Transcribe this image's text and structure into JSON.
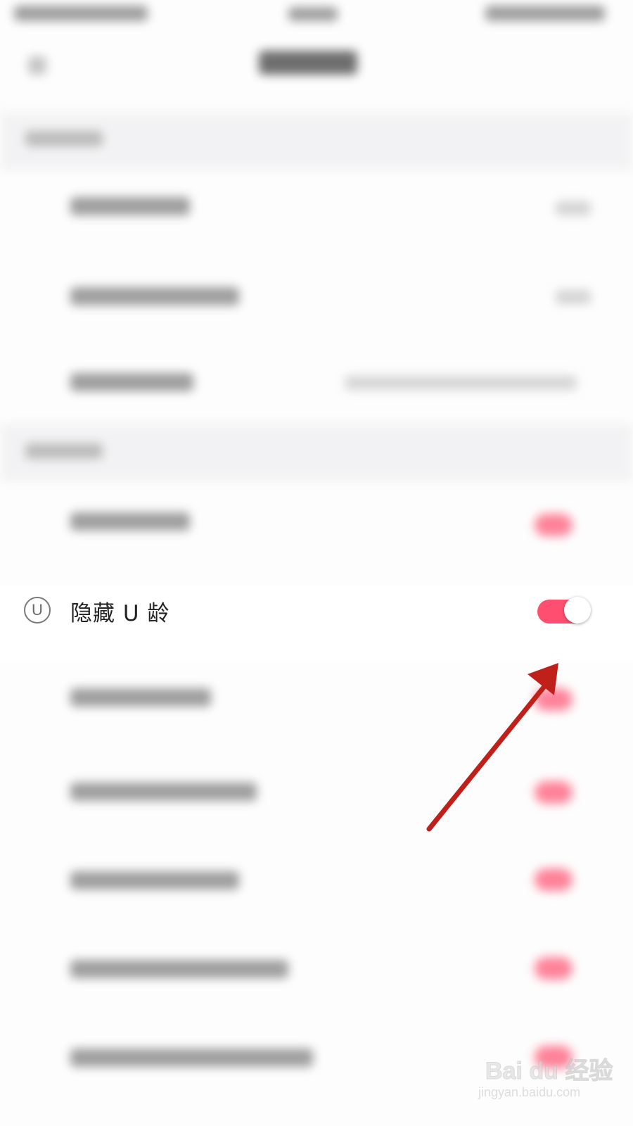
{
  "settings_row": {
    "icon": "u-circle-icon",
    "icon_glyph": "U",
    "label": "隐藏 U 龄",
    "toggle_on": true
  },
  "colors": {
    "toggle_on": "#ff4f70",
    "arrow": "#c0201a"
  },
  "watermark": {
    "logo": "Bai du 经验",
    "url": "jingyan.baidu.com"
  }
}
